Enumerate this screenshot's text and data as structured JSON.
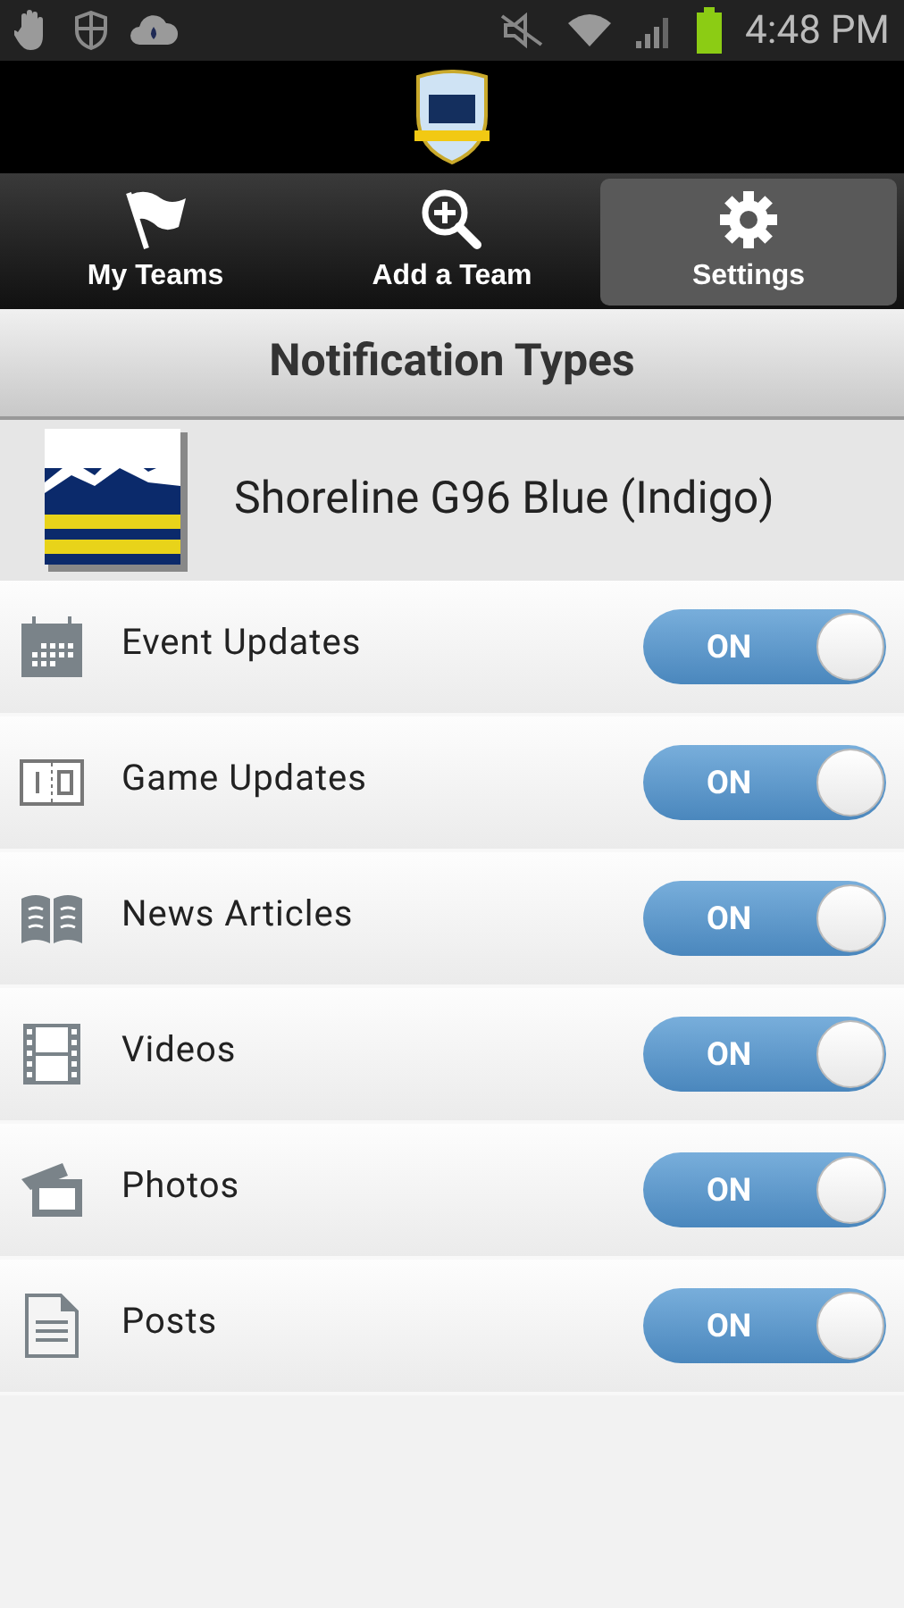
{
  "status_bar": {
    "time": "4:48 PM"
  },
  "tabs": [
    {
      "label": "My Teams",
      "kind": "flag",
      "selected": false
    },
    {
      "label": "Add a Team",
      "kind": "add",
      "selected": false
    },
    {
      "label": "Settings",
      "kind": "gear",
      "selected": true
    }
  ],
  "title": "Notification Types",
  "team": {
    "name": "Shoreline G96 Blue (Indigo)"
  },
  "settings": [
    {
      "label": "Event Updates",
      "kind": "calendar",
      "on": true,
      "state_text": "ON"
    },
    {
      "label": "Game Updates",
      "kind": "score",
      "on": true,
      "state_text": "ON"
    },
    {
      "label": "News Articles",
      "kind": "book",
      "on": true,
      "state_text": "ON"
    },
    {
      "label": "Videos",
      "kind": "film",
      "on": true,
      "state_text": "ON"
    },
    {
      "label": "Photos",
      "on": true,
      "state_text": "ON"
    },
    {
      "label": "Posts",
      "kind": "doc",
      "on": true,
      "state_text": "ON"
    }
  ]
}
